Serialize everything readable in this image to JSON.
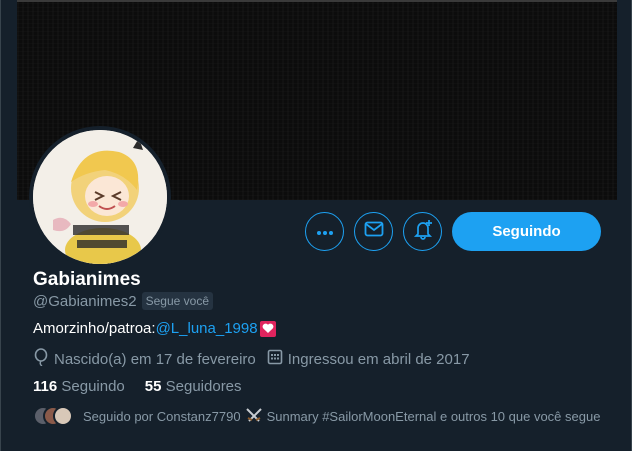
{
  "profile": {
    "display_name": "Gabianimes",
    "handle": "@Gabianimes2",
    "follows_you_badge": "Segue você",
    "bio_text": "Amorzinho/patroa:",
    "bio_link": "@L_luna_1998",
    "birthday": "Nascido(a) em 17 de fevereiro",
    "joined": "Ingressou em abril de 2017"
  },
  "actions": {
    "follow_label": "Seguindo",
    "more_icon": "more-icon",
    "message_icon": "envelope-icon",
    "notify_icon": "bell-plus-icon"
  },
  "stats": {
    "following_count": "116",
    "following_label": "Seguindo",
    "followers_count": "55",
    "followers_label": "Seguidores"
  },
  "followed_by": {
    "prefix": "Seguido por Constanz7790",
    "middle": "Sunmary #SailorMoonEternal e outros 10 que você segue"
  },
  "colors": {
    "accent": "#1da1f2",
    "background": "#15202b",
    "secondary_text": "#8899a6",
    "heart": "#e0245e"
  }
}
